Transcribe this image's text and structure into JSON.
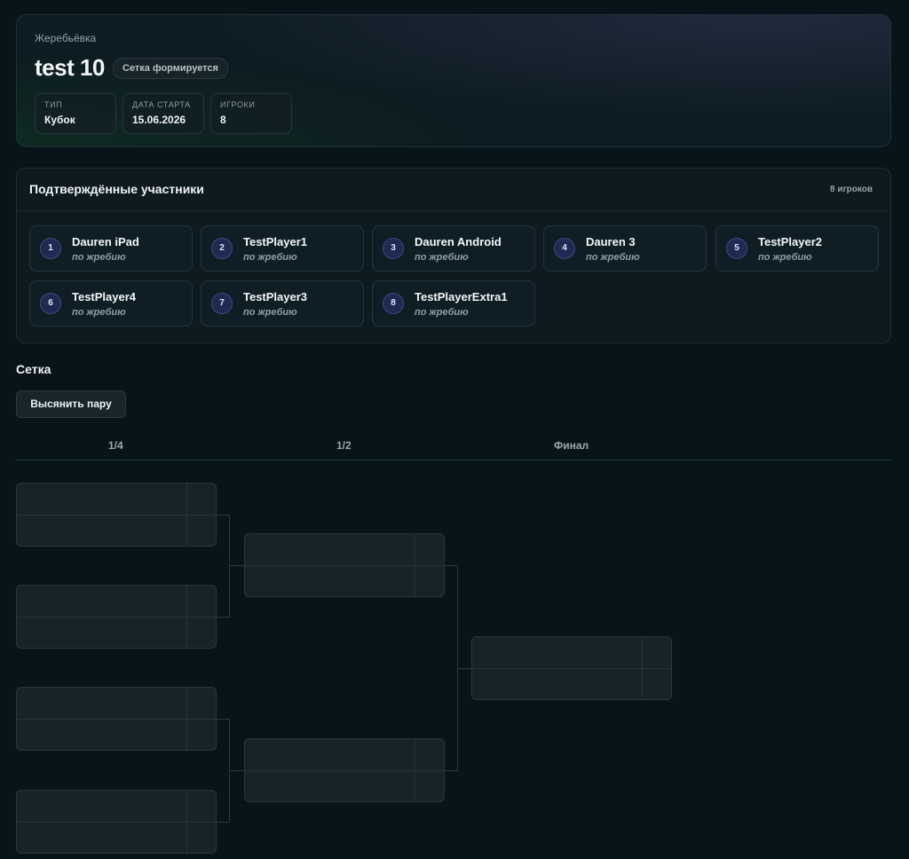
{
  "header": {
    "breadcrumb": "Жеребьёвка",
    "title": "test 10",
    "status_badge": "Сетка формируется",
    "stats": [
      {
        "key": "ТИП",
        "value": "Кубок"
      },
      {
        "key": "ДАТА СТАРТА",
        "value": "15.06.2026"
      },
      {
        "key": "ИГРОКИ",
        "value": "8"
      }
    ]
  },
  "participants": {
    "title": "Подтверждённые участники",
    "count_label": "8 игроков",
    "items": [
      {
        "num": "1",
        "name": "Dauren iPad",
        "sub": "по жребию"
      },
      {
        "num": "2",
        "name": "TestPlayer1",
        "sub": "по жребию"
      },
      {
        "num": "3",
        "name": "Dauren Android",
        "sub": "по жребию"
      },
      {
        "num": "4",
        "name": "Dauren 3",
        "sub": "по жребию"
      },
      {
        "num": "5",
        "name": "TestPlayer2",
        "sub": "по жребию"
      },
      {
        "num": "6",
        "name": "TestPlayer4",
        "sub": "по жребию"
      },
      {
        "num": "7",
        "name": "TestPlayer3",
        "sub": "по жребию"
      },
      {
        "num": "8",
        "name": "TestPlayerExtra1",
        "sub": "по жребию"
      }
    ]
  },
  "bracket": {
    "title": "Сетка",
    "action_label": "Высянить пару",
    "rounds": [
      "1/4",
      "1/2",
      "Финал"
    ]
  },
  "colors": {
    "background": "#07141a",
    "card": "#0d1a1f",
    "badge_number": "#1f2a52",
    "accent_line": "#1d3a33"
  }
}
